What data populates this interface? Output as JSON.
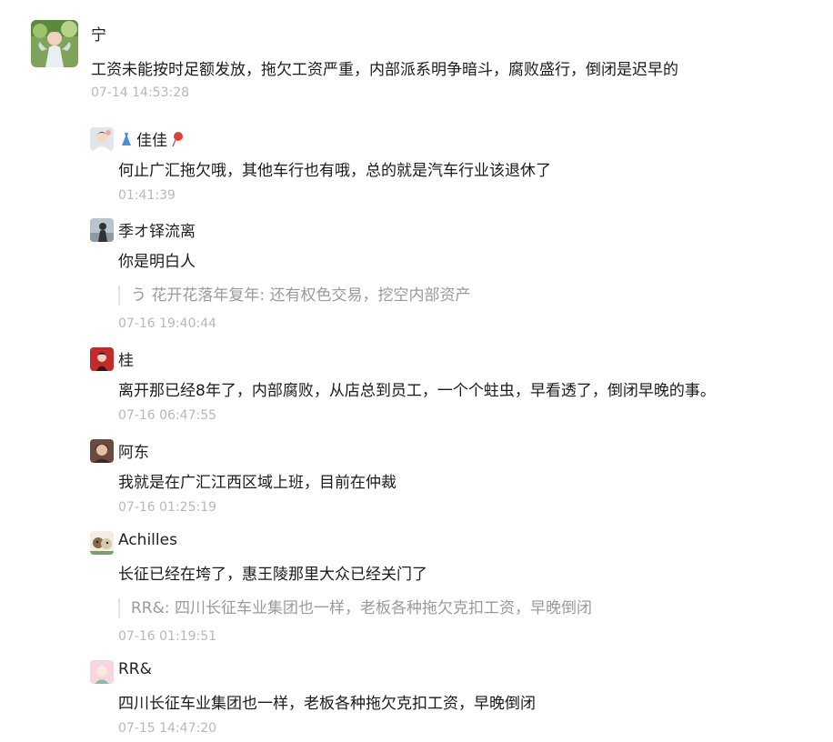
{
  "main_comment": {
    "avatar_icon": "fairy-girl-avatar",
    "name": "宁",
    "text": "工资未能按时足额发放，拖欠工资严重，内部派系明争暗斗，腐败盛行，倒闭是迟早的",
    "time": "07-14 14:53:28"
  },
  "replies": [
    {
      "avatar_icon": "girl-avatar",
      "name": "佳佳",
      "name_prefix_icon": "dress-icon",
      "name_suffix_icon": "pin-icon",
      "text": "何止广汇拖欠哦，其他车行也有哦，总的就是汽车行业该退休了",
      "time": "01:41:39"
    },
    {
      "avatar_icon": "silhouette-avatar",
      "name": "季オ铎流离",
      "text": "你是明白人",
      "quote": "う 花开花落年复年: 还有权色交易，挖空内部资产",
      "time": "07-16 19:40:44"
    },
    {
      "avatar_icon": "red-avatar",
      "name": "桂",
      "text": "离开那已经8年了，内部腐败，从店总到员工，一个个蛀虫，早看透了，倒闭早晚的事。",
      "time": "07-16 06:47:55"
    },
    {
      "avatar_icon": "portrait-avatar",
      "name": "阿东",
      "text": "我就是在广汇江西区域上班，目前在仲裁",
      "time": "07-16 01:25:19"
    },
    {
      "avatar_icon": "cartoon-avatar",
      "name": "Achilles",
      "text": "长征已经在垮了，惠王陵那里大众已经关门了",
      "quote": "RR&: 四川长征车业集团也一样，老板各种拖欠克扣工资，早晚倒闭",
      "time": "07-16 01:19:51"
    },
    {
      "avatar_icon": "pink-cartoon-avatar",
      "name": "RR&",
      "text": "四川长征车业集团也一样，老板各种拖欠克扣工资，早晚倒闭",
      "time": "07-15 14:47:20"
    }
  ]
}
